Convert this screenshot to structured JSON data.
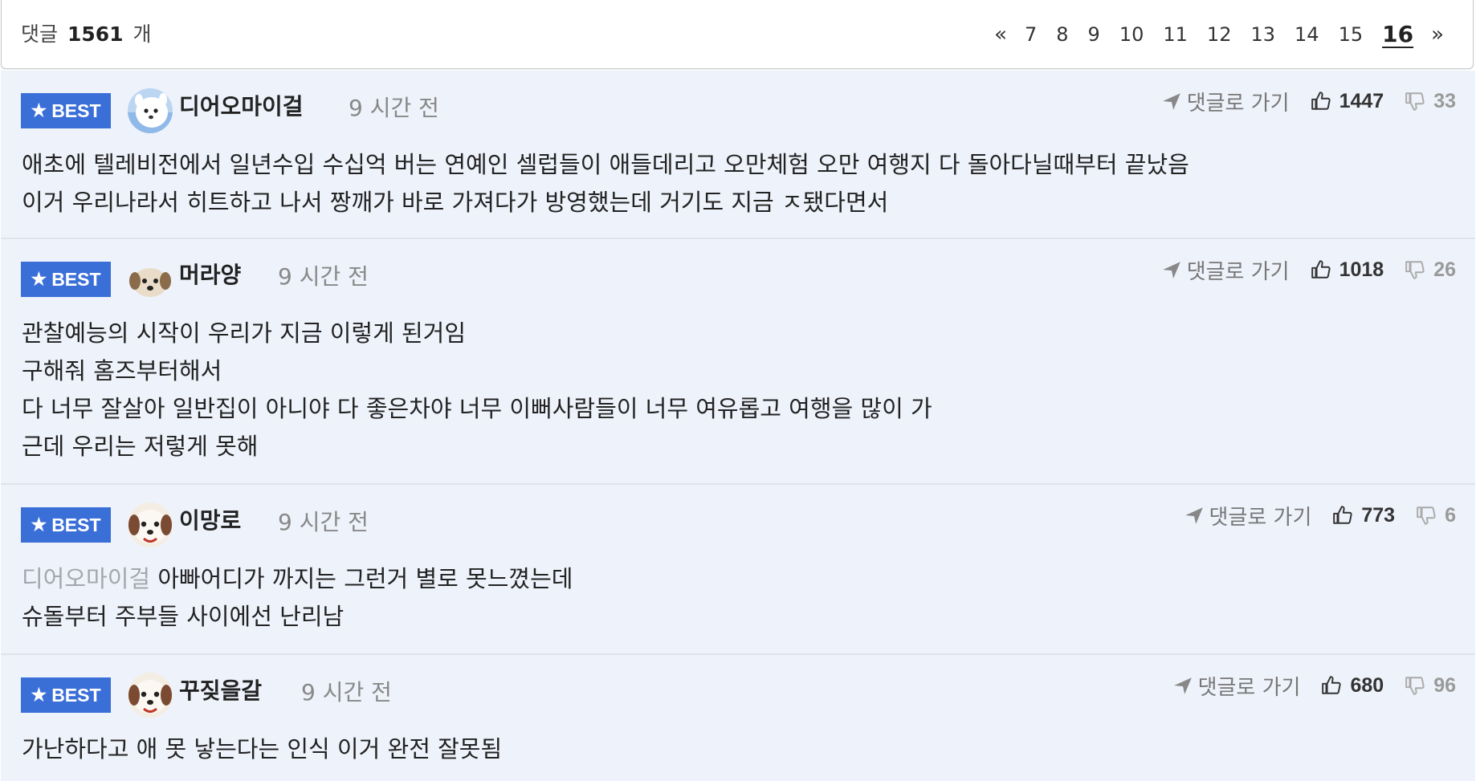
{
  "header": {
    "count_prefix": "댓글",
    "count_value": "1561",
    "count_suffix": "개"
  },
  "pagination": {
    "prev": "«",
    "next": "»",
    "pages": [
      "7",
      "8",
      "9",
      "10",
      "11",
      "12",
      "13",
      "14",
      "15",
      "16"
    ],
    "current": "16"
  },
  "comments": [
    {
      "badge": "BEST",
      "avatar": "white-dog-avatar",
      "nickname": "디어오마이걸",
      "time": "9 시간 전",
      "goto_label": "댓글로 가기",
      "likes": "1447",
      "dislikes": "33",
      "lines": [
        "애초에 텔레비전에서 일년수입 수십억 버는 연예인 셀럽들이 애들데리고 오만체험 오만 여행지 다 돌아다닐때부터 끝났음",
        "이거 우리나라서 히트하고 나서 짱깨가 바로 가져다가 방영했는데 거기도 지금 ㅈ됐다면서"
      ]
    },
    {
      "badge": "BEST",
      "avatar": "puppy-avatar",
      "nickname": "머라양",
      "time": "9 시간 전",
      "goto_label": "댓글로 가기",
      "likes": "1018",
      "dislikes": "26",
      "lines": [
        "관찰예능의 시작이 우리가 지금 이렇게 된거임",
        "구해줘 홈즈부터해서",
        "다 너무 잘살아 일반집이 아니야 다 좋은차야 너무 이뻐사람들이 너무 여유롭고 여행을 많이 가",
        "근데 우리는 저렇게 못해"
      ]
    },
    {
      "badge": "BEST",
      "avatar": "dog-face-avatar",
      "nickname": "이망로",
      "time": "9 시간 전",
      "goto_label": "댓글로 가기",
      "likes": "773",
      "dislikes": "6",
      "mention": "디어오마이걸",
      "first_line_rest": "아빠어디가 까지는 그런거 별로 못느꼈는데",
      "lines": [
        "슈돌부터 주부들 사이에선 난리남"
      ]
    },
    {
      "badge": "BEST",
      "avatar": "dog-face-avatar",
      "nickname": "꾸짖을갈",
      "time": "9 시간 전",
      "goto_label": "댓글로 가기",
      "likes": "680",
      "dislikes": "96",
      "lines": [
        "가난하다고 애 못 낳는다는 인식 이거 완전 잘못됨"
      ]
    }
  ],
  "colors": {
    "badge": "#3b6fd8",
    "comment_bg": "#eef2fa",
    "mention": "#a4a6ad",
    "time": "#888888"
  }
}
